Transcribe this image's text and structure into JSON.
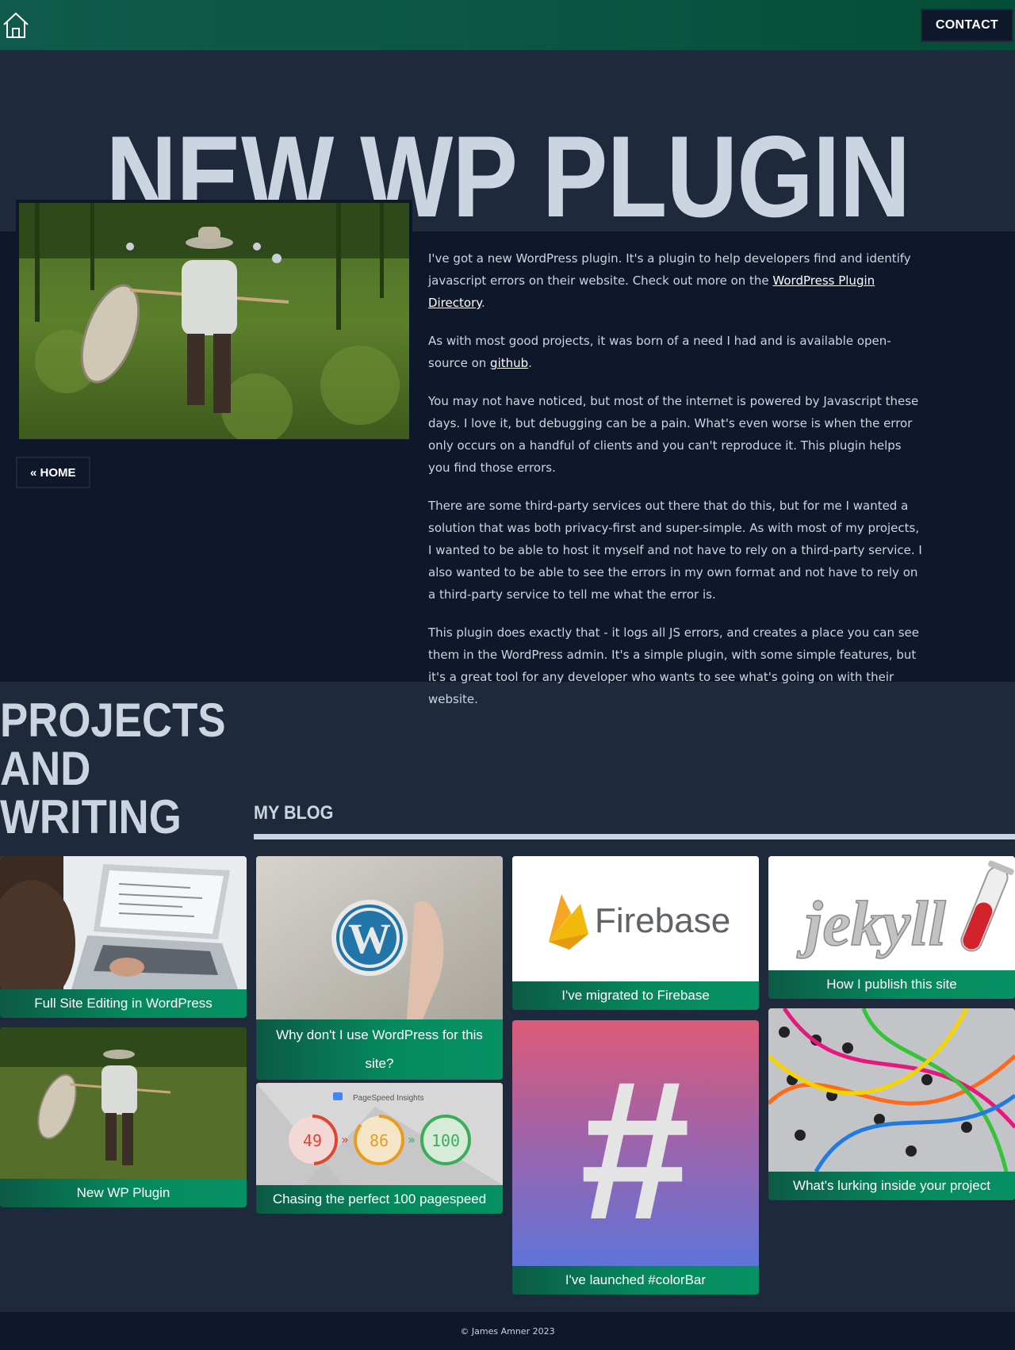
{
  "header": {
    "home_icon": "home-icon",
    "contact_label": "CONTACT"
  },
  "hero": {
    "title": "NEW WP PLUGIN"
  },
  "article": {
    "home_button": "« HOME",
    "p1_before": "I've got a new WordPress plugin. It's a plugin to help developers find and identify javascript errors on their website. Check out more on the ",
    "p1_link": "WordPress Plugin Directory",
    "p1_after": ".",
    "p2_before": "As with most good projects, it was born of a need I had and is available open-source on ",
    "p2_link": "github",
    "p2_after": ".",
    "p3": "You may not have noticed, but most of the internet is powered by Javascript these days. I love it, but debugging can be a pain. What's even worse is when the error only occurs on a handful of clients and you can't reproduce it. This plugin helps you find those errors.",
    "p4": "There are some third-party services out there that do this, but for me I wanted a solution that was both privacy-first and super-simple. As with most of my projects, I wanted to be able to host it myself and not have to rely on a third-party service. I also wanted to be able to see the errors in my own format and not have to rely on a third-party service to tell me what the error is.",
    "p5": "This plugin does exactly that - it logs all JS errors, and creates a place you can see them in the WordPress admin. It's a simple plugin, with some simple features, but it's a great tool for any developer who wants to see what's going on with their website."
  },
  "projects": {
    "heading_line1": "PROJECTS",
    "heading_line2": "AND",
    "heading_line3": "WRITING",
    "blog_heading": "MY BLOG",
    "cards": [
      {
        "label": "Full Site Editing in WordPress"
      },
      {
        "label": "New WP Plugin"
      },
      {
        "label": "Why don't I use WordPress for this site?"
      },
      {
        "label": "Chasing the perfect 100 pagespeed"
      },
      {
        "label": "I've migrated to Firebase"
      },
      {
        "label": "I've launched #colorBar"
      },
      {
        "label": "How I publish this site"
      },
      {
        "label": "What's lurking inside your project"
      }
    ],
    "firebase_logo_text": "Firebase",
    "jekyll_logo_text": "jekyll",
    "pagespeed": {
      "title": "PageSpeed Insights",
      "scores": [
        "49",
        "86",
        "100"
      ],
      "arrow": "»"
    },
    "colorbar_symbol": "#"
  },
  "footer": {
    "copyright": "© James Amner 2023"
  }
}
